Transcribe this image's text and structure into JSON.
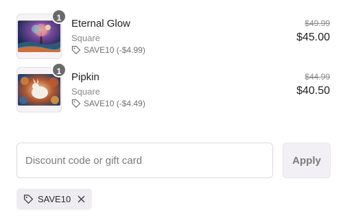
{
  "cart": {
    "items": [
      {
        "title": "Eternal Glow",
        "variant": "Square",
        "quantity": "1",
        "discount": "SAVE10 (-$4.99)",
        "original_price": "$49.99",
        "final_price": "$45.00"
      },
      {
        "title": "Pipkin",
        "variant": "Square",
        "quantity": "1",
        "discount": "SAVE10 (-$4.49)",
        "original_price": "$44.99",
        "final_price": "$40.50"
      }
    ]
  },
  "discount_form": {
    "placeholder": "Discount code or gift card",
    "value": "",
    "apply_label": "Apply"
  },
  "applied_codes": [
    {
      "code": "SAVE10"
    }
  ],
  "colors": {
    "badge": "#6b6b6b",
    "muted_text": "#8a8a8a",
    "chip_bg": "#efecf1"
  }
}
